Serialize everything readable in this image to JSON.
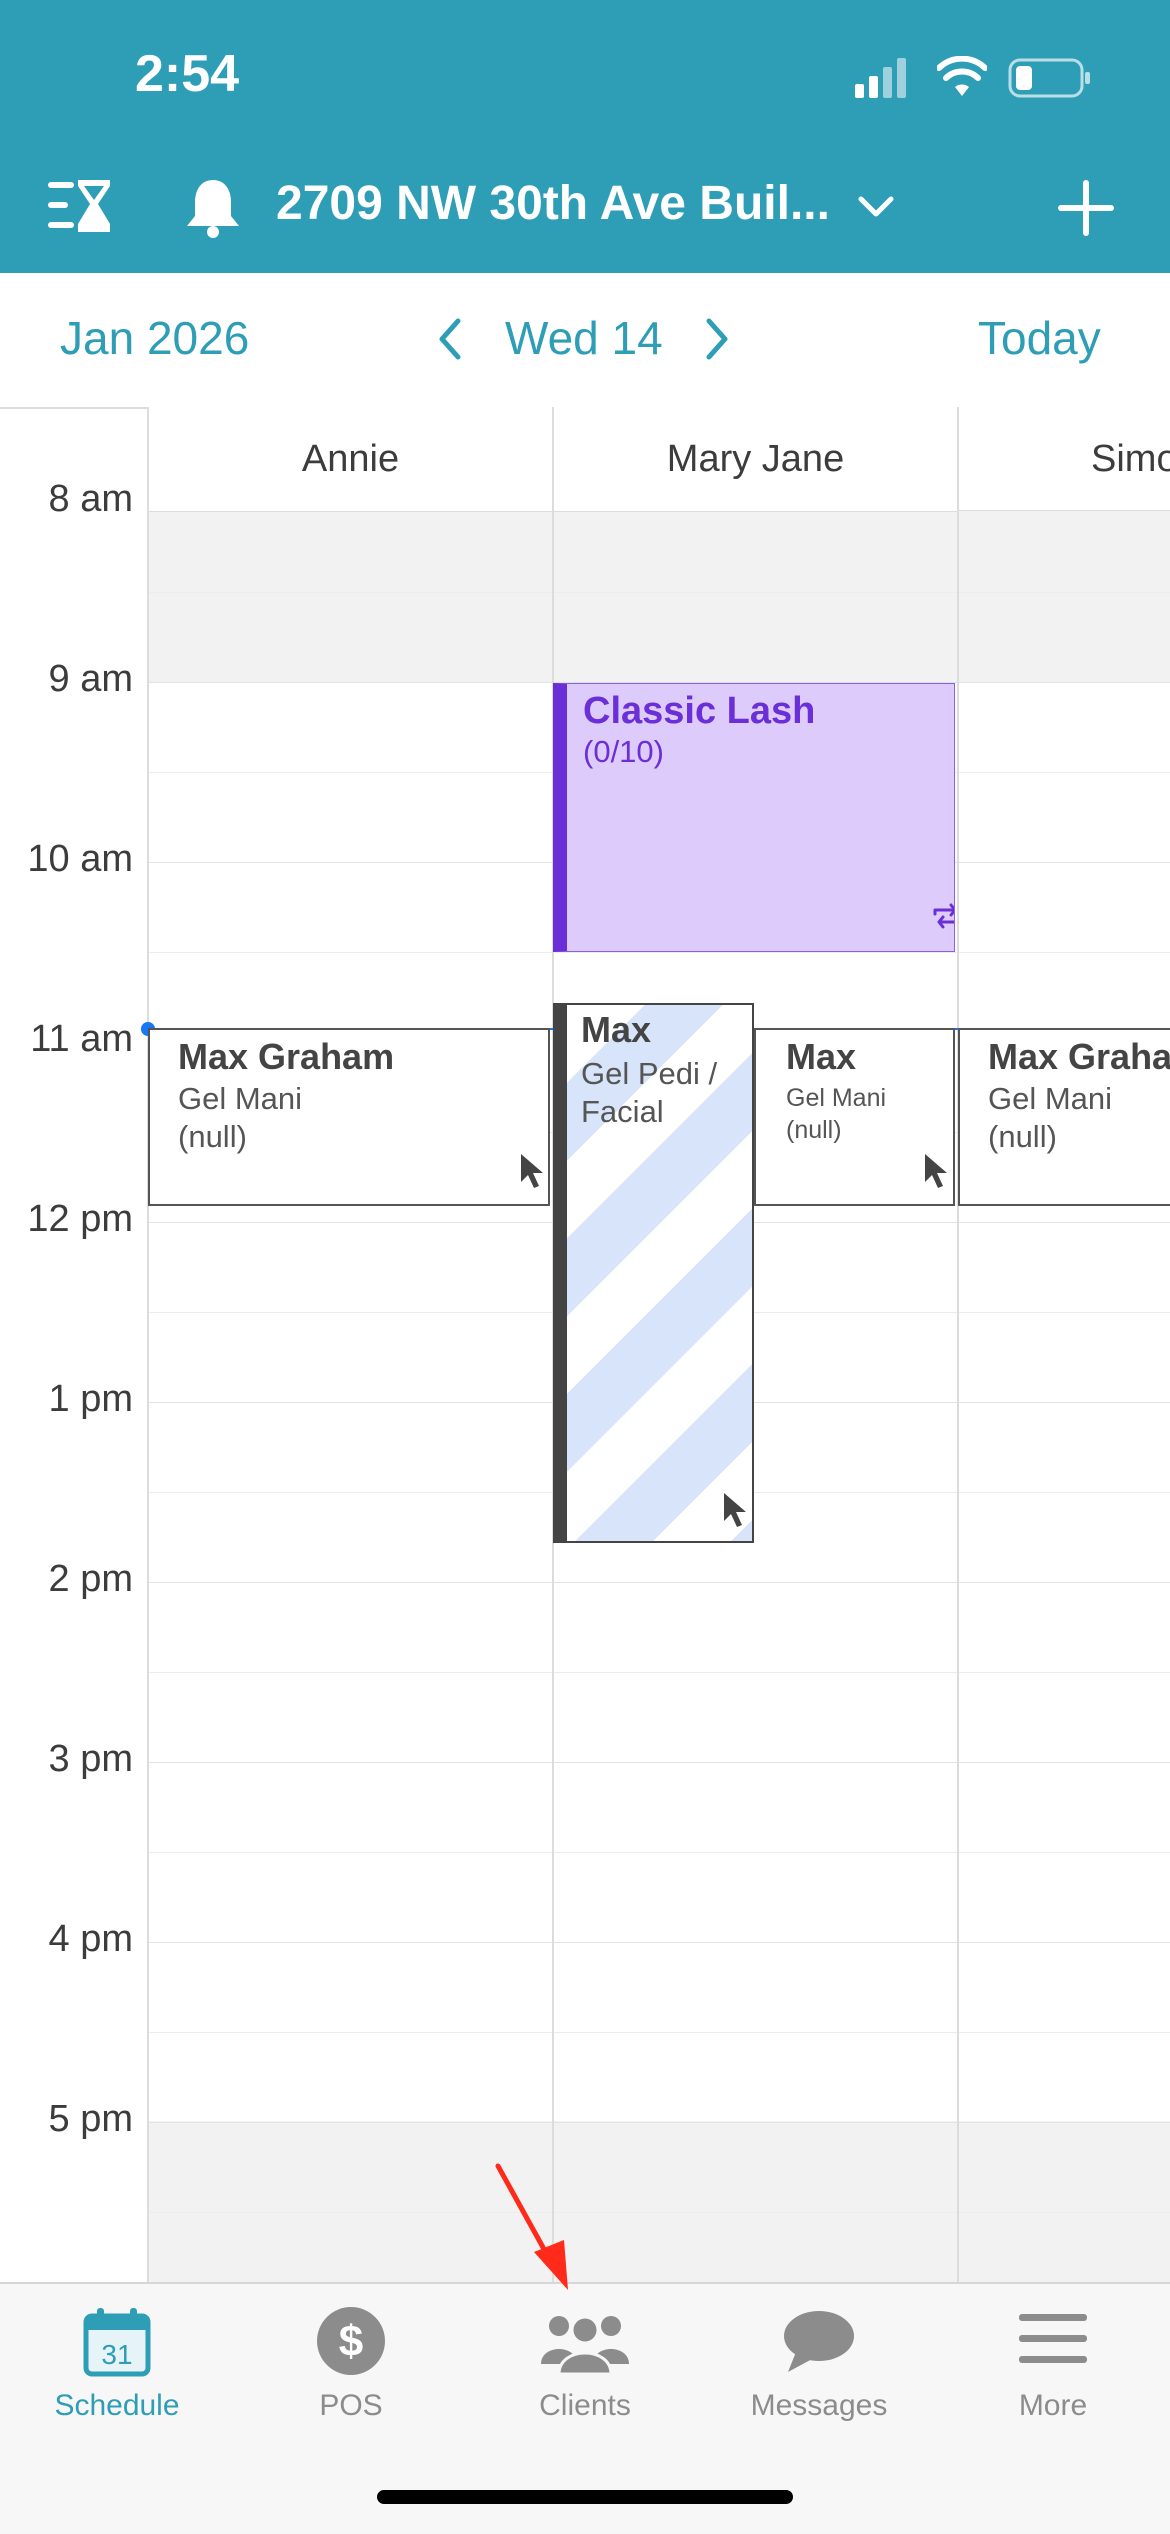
{
  "status_bar": {
    "time": "2:54"
  },
  "nav": {
    "title": "2709 NW 30th Ave Buil...",
    "icons": [
      "waitlist-hourglass-icon",
      "bell-icon",
      "chevron-down-icon",
      "plus-icon"
    ]
  },
  "date_bar": {
    "month": "Jan 2026",
    "day": "Wed 14",
    "today": "Today"
  },
  "columns": [
    "Annie",
    "Mary Jane",
    "Simo"
  ],
  "time_labels": [
    "8 am",
    "9 am",
    "10 am",
    "11 am",
    "12 pm",
    "1 pm",
    "2 pm",
    "3 pm",
    "4 pm",
    "5 pm"
  ],
  "events": {
    "class": {
      "title": "Classic Lash",
      "capacity": "(0/10)",
      "color": "#6a2fd6",
      "bg": "#ddcbfb"
    },
    "annie": {
      "name": "Max Graham",
      "service": "Gel Mani",
      "note": "(null)"
    },
    "mj_block": {
      "name": "Max",
      "service_line1": "Gel Pedi /",
      "service_line2": "Facial"
    },
    "mj_small": {
      "name": "Max",
      "service": "Gel Mani",
      "note": "(null)"
    },
    "simo": {
      "name": "Max Graha",
      "service": "Gel Mani",
      "note": "(null)"
    }
  },
  "tabs": [
    {
      "label": "Schedule",
      "icon": "calendar-31-icon",
      "active": true
    },
    {
      "label": "POS",
      "icon": "dollar-icon",
      "active": false
    },
    {
      "label": "Clients",
      "icon": "clients-icon",
      "active": false
    },
    {
      "label": "Messages",
      "icon": "chat-bubble-icon",
      "active": false
    },
    {
      "label": "More",
      "icon": "hamburger-menu-icon",
      "active": false
    }
  ],
  "calendar_icon_day": "31",
  "colors": {
    "brand": "#2e9db6",
    "current_time": "#1877f2",
    "arrow": "#ff2a1a"
  }
}
